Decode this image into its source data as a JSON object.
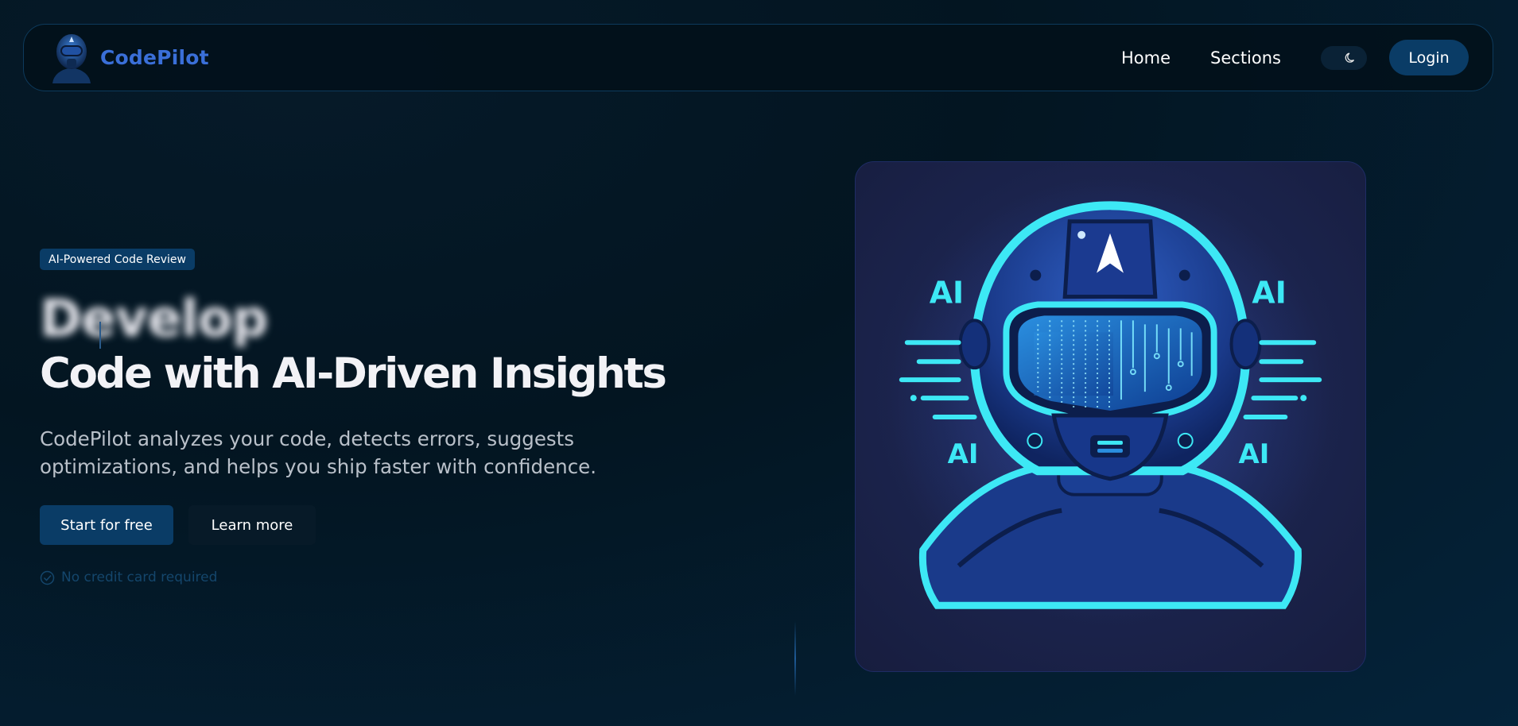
{
  "navbar": {
    "brand": "CodePilot",
    "links": [
      "Home",
      "Sections"
    ],
    "login_label": "Login"
  },
  "hero": {
    "badge": "AI-Powered Code Review",
    "animated_word": "Develop",
    "headline": "Code with AI-Driven Insights",
    "subtext": "CodePilot analyzes your code, detects errors, suggests optimizations, and helps you ship faster with confidence.",
    "primary_cta": "Start for free",
    "secondary_cta": "Learn more",
    "note": "No credit card required"
  },
  "illustration": {
    "labels": [
      "AI",
      "AI",
      "AI",
      "AI"
    ]
  },
  "colors": {
    "accent": "#0a3c66",
    "brand": "#3a6fd8",
    "glow": "#3de8f5"
  }
}
